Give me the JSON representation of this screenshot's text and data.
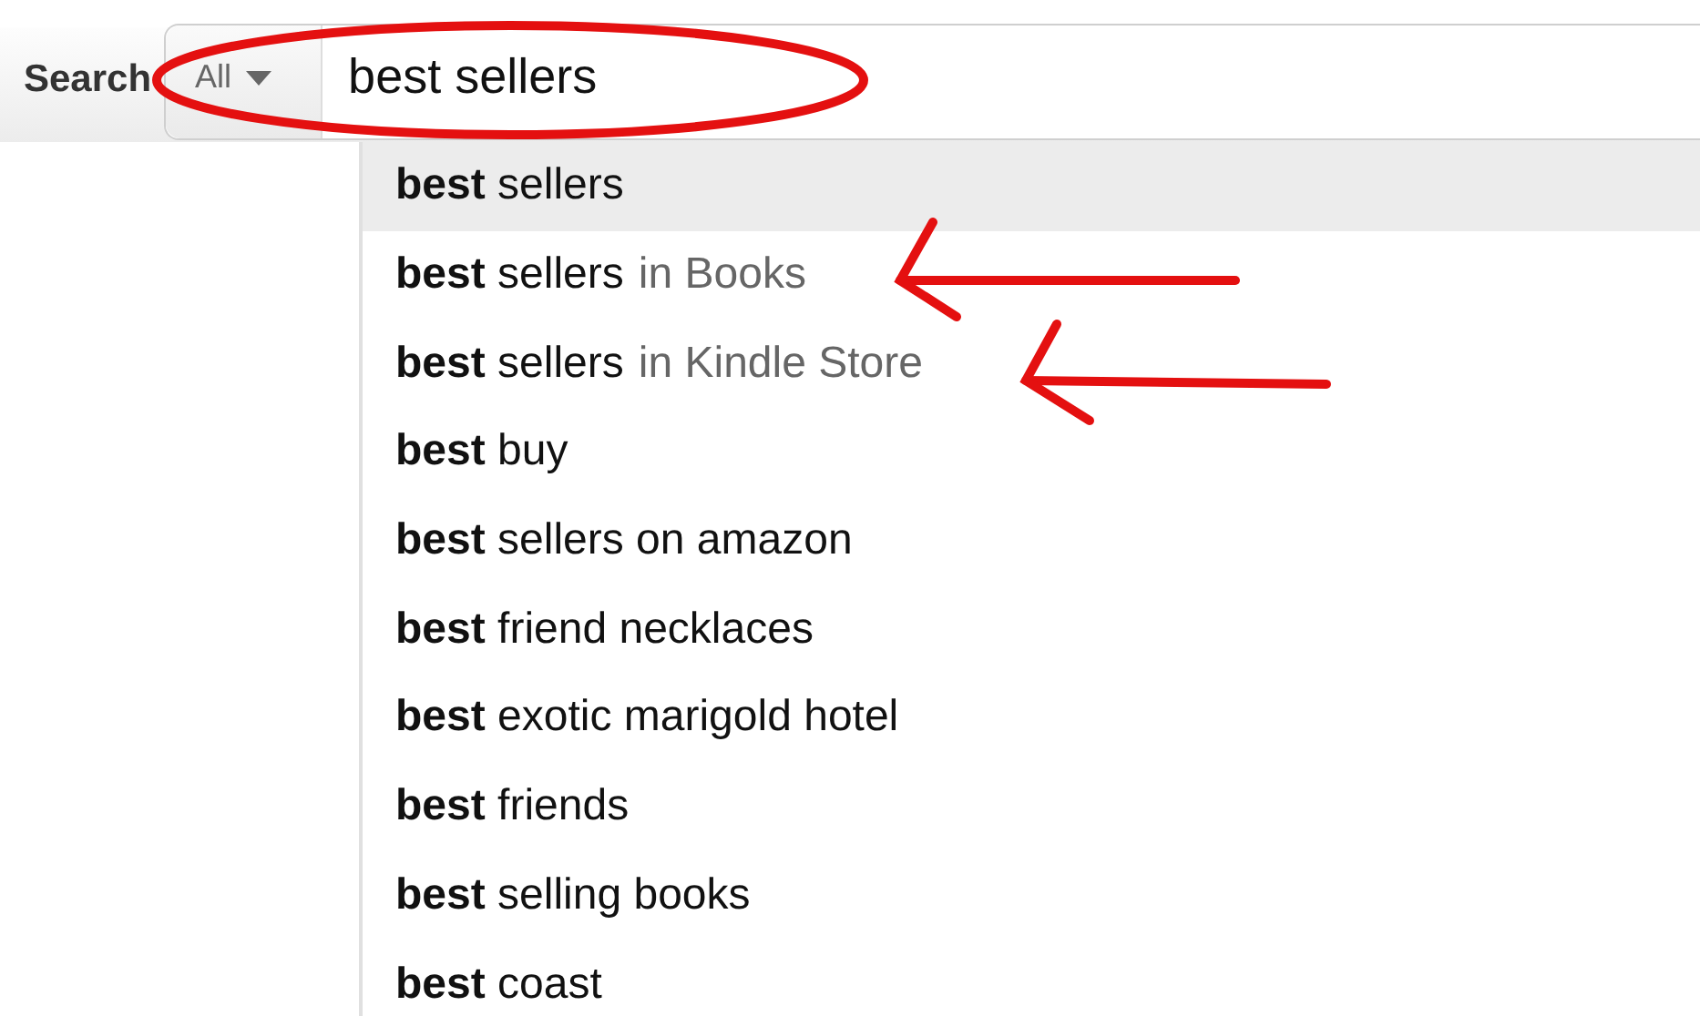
{
  "search_bar": {
    "label": "Search",
    "category": "All",
    "query": "best sellers"
  },
  "suggestions": [
    {
      "text": "**best** sellers",
      "selected": true
    },
    {
      "text": "**best** sellers",
      "department": "in Books",
      "selected": false
    },
    {
      "text": "**best** sellers",
      "department": "in Kindle Store",
      "selected": false
    },
    {
      "text": "**best** buy",
      "selected": false
    },
    {
      "text": "**best** sellers on amazon",
      "selected": false
    },
    {
      "text": "**best** friend necklaces",
      "selected": false
    },
    {
      "text": "**best** exotic marigold hotel",
      "selected": false
    },
    {
      "text": "**best** friends",
      "selected": false
    },
    {
      "text": "**best** selling books",
      "selected": false
    },
    {
      "text": "**best** coast",
      "selected": false
    }
  ]
}
